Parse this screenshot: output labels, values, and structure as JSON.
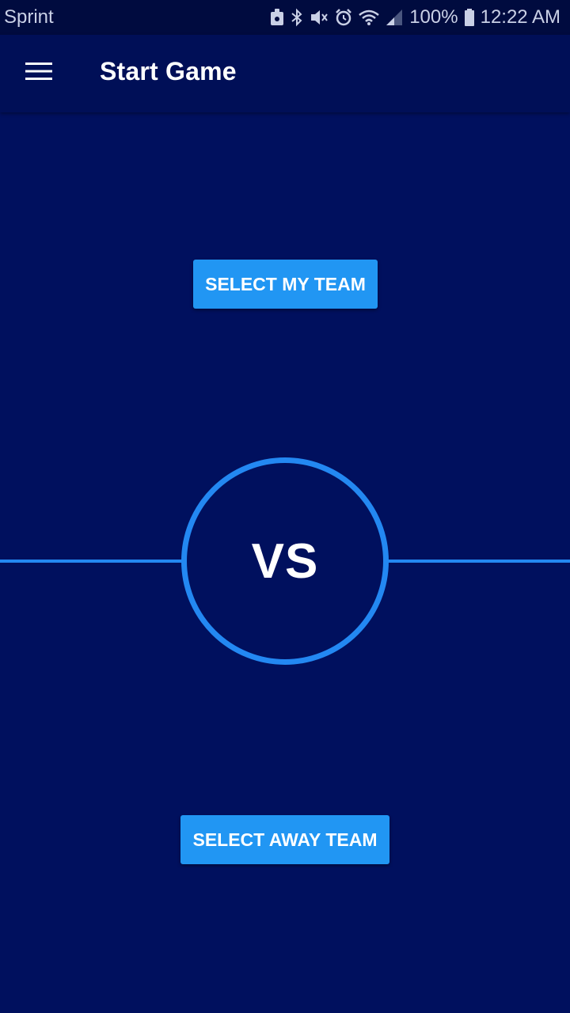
{
  "status_bar": {
    "carrier": "Sprint",
    "battery_percent": "100%",
    "time": "12:22 AM",
    "icons": [
      "lock-icon",
      "bluetooth-icon",
      "mute-icon",
      "alarm-icon",
      "wifi-icon",
      "signal-icon",
      "battery-icon"
    ]
  },
  "app_bar": {
    "title": "Start Game",
    "menu_icon": "hamburger-menu-icon"
  },
  "main": {
    "select_my_team_label": "SELECT MY TEAM",
    "vs_label": "VS",
    "select_away_team_label": "SELECT AWAY TEAM"
  },
  "colors": {
    "background": "#00105e",
    "app_bar": "#000f57",
    "status_bar": "#000b3f",
    "accent": "#2196f3",
    "vs_ring": "#2388f2",
    "text": "#ffffff"
  }
}
